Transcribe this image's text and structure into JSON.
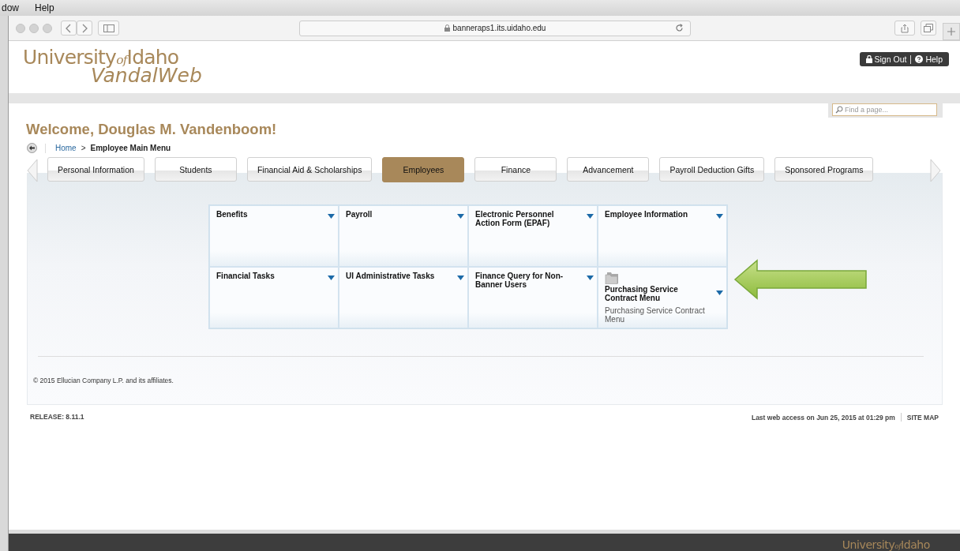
{
  "os_menu": [
    "dow",
    "Help"
  ],
  "browser": {
    "address": "banneraps1.its.uidaho.edu"
  },
  "logo": {
    "university": "University",
    "of": "of",
    "idaho": "Idaho",
    "line2": "VandalWeb"
  },
  "header_links": [
    "Sign Out",
    "Help"
  ],
  "search": {
    "placeholder": "Find a page..."
  },
  "welcome": "Welcome, Douglas M. Vandenboom!",
  "breadcrumb": {
    "home": "Home",
    "separator": ">",
    "current": "Employee Main Menu"
  },
  "tabs": [
    {
      "label": "Personal Information",
      "selected": false
    },
    {
      "label": "Students",
      "selected": false
    },
    {
      "label": "Financial Aid & Scholarships",
      "selected": false
    },
    {
      "label": "Employees",
      "selected": true
    },
    {
      "label": "Finance",
      "selected": false
    },
    {
      "label": "Advancement",
      "selected": false
    },
    {
      "label": "Payroll Deduction Gifts",
      "selected": false
    },
    {
      "label": "Sponsored Programs",
      "selected": false
    }
  ],
  "menu_tiles": [
    {
      "kind": "plain",
      "title": "Benefits"
    },
    {
      "kind": "plain",
      "title": "Payroll"
    },
    {
      "kind": "plain",
      "title": "Electronic Personnel Action Form (EPAF)"
    },
    {
      "kind": "plain",
      "title": "Employee Information"
    },
    {
      "kind": "plain",
      "title": "Financial Tasks"
    },
    {
      "kind": "plain",
      "title": "UI Administrative Tasks"
    },
    {
      "kind": "plain",
      "title": "Finance Query for Non-Banner Users"
    },
    {
      "kind": "folder",
      "title": "Purchasing Service Contract Menu",
      "description": "Purchasing Service Contract Menu"
    }
  ],
  "copyright": "© 2015 Ellucian Company L.P. and its affiliates.",
  "release": "RELEASE: 8.11.1",
  "last_access": "Last web access on Jun 25, 2015 at 01:29 pm",
  "site_map": "SITE MAP",
  "footer_logo": {
    "university": "University",
    "of": "of",
    "idaho": "Idaho"
  }
}
